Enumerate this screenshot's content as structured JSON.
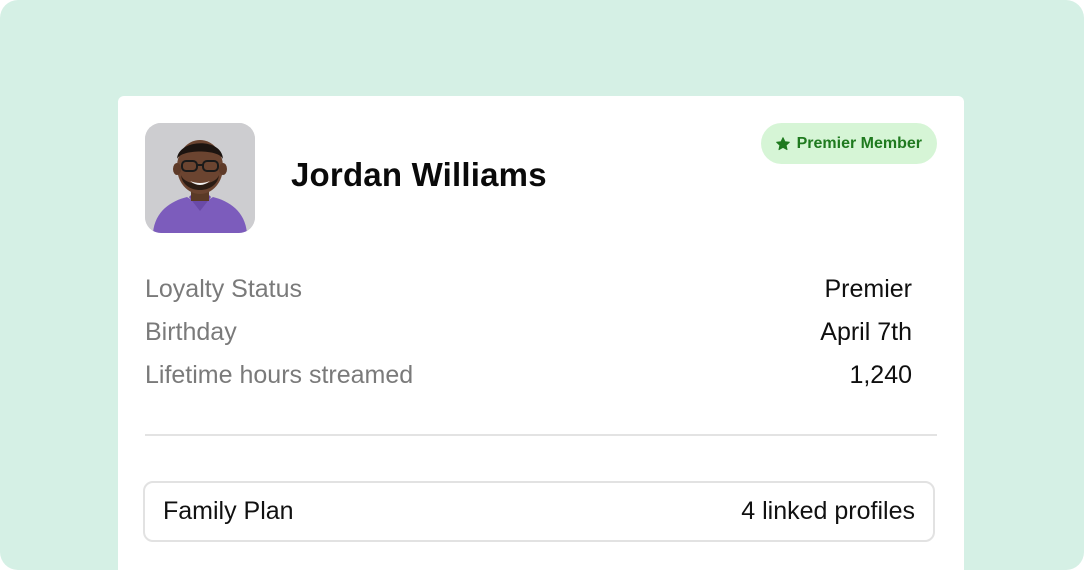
{
  "profile": {
    "name": "Jordan Williams",
    "badge": {
      "label": "Premier Member",
      "icon": "star-icon",
      "color": "#1f7a1f",
      "background": "#d6f5d6"
    }
  },
  "details": [
    {
      "label": "Loyalty Status",
      "value": "Premier"
    },
    {
      "label": "Birthday",
      "value": "April 7th"
    },
    {
      "label": "Lifetime hours streamed",
      "value": "1,240"
    }
  ],
  "plan": {
    "name": "Family Plan",
    "summary": "4 linked profiles"
  },
  "colors": {
    "backdrop": "#d5f0e5",
    "card": "#ffffff"
  }
}
